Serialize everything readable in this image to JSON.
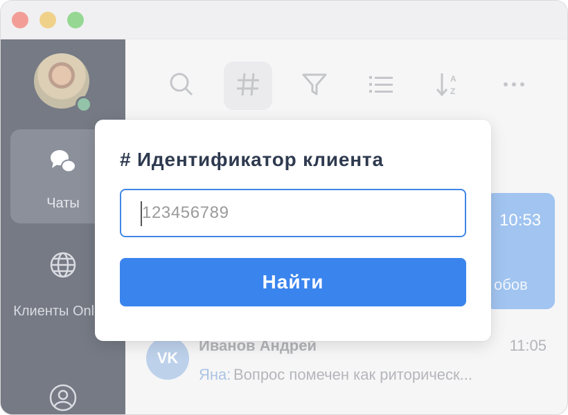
{
  "window": {
    "controls": [
      "close",
      "minimize",
      "zoom"
    ]
  },
  "sidebar": {
    "items": [
      {
        "label": "Чаты",
        "icon": "chat-bubbles-icon",
        "active": true
      },
      {
        "label": "Клиенты Online",
        "icon": "globe-icon",
        "active": false
      },
      {
        "label": "",
        "icon": "user-circle-icon",
        "active": false
      }
    ],
    "status_color": "#5aa37a"
  },
  "toolbar": {
    "buttons": [
      {
        "icon": "search-icon"
      },
      {
        "icon": "hash-icon",
        "active": true
      },
      {
        "icon": "filter-icon"
      },
      {
        "icon": "list-icon"
      },
      {
        "icon": "sort-az-icon"
      },
      {
        "icon": "more-icon"
      }
    ]
  },
  "chats": [
    {
      "time": "10:53",
      "snippet": "обов",
      "selected": true
    },
    {
      "name": "Иванов Андрей",
      "time": "11:05",
      "sender": "Яна:",
      "preview": "Вопрос помечен как риторическ...",
      "source": "VK"
    }
  ],
  "modal": {
    "title": "# Идентификатор клиента",
    "input_placeholder": "123456789",
    "button_label": "Найти"
  },
  "colors": {
    "accent": "#3a84ee",
    "sidebar_bg": "#2b3343",
    "title_text": "#2e3a4f"
  }
}
